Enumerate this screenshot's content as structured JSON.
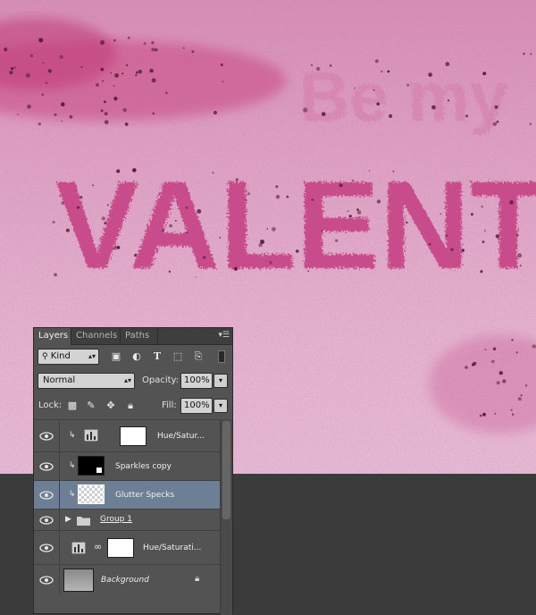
{
  "canvas": {
    "line1": "Be my",
    "line2": "VALENT",
    "colors": {
      "bg_top": "#d68fb6",
      "bg_bottom": "#e6bbd4",
      "text": "#c74688",
      "speck": "#5a1f3c"
    }
  },
  "panel": {
    "tabs": [
      "Layers",
      "Channels",
      "Paths"
    ],
    "filter": {
      "value": "Kind"
    },
    "blend_mode": {
      "value": "Normal"
    },
    "opacity": {
      "label": "Opacity:",
      "value": "100%"
    },
    "lock": {
      "label": "Lock:"
    },
    "fill": {
      "label": "Fill:",
      "value": "100%"
    },
    "layers": [
      {
        "name": "Hue/Satur..."
      },
      {
        "name": "Sparkles copy"
      },
      {
        "name": "Glutter Specks"
      },
      {
        "name": "Group 1"
      },
      {
        "name": "Hue/Saturati..."
      },
      {
        "name": "Background"
      }
    ]
  }
}
